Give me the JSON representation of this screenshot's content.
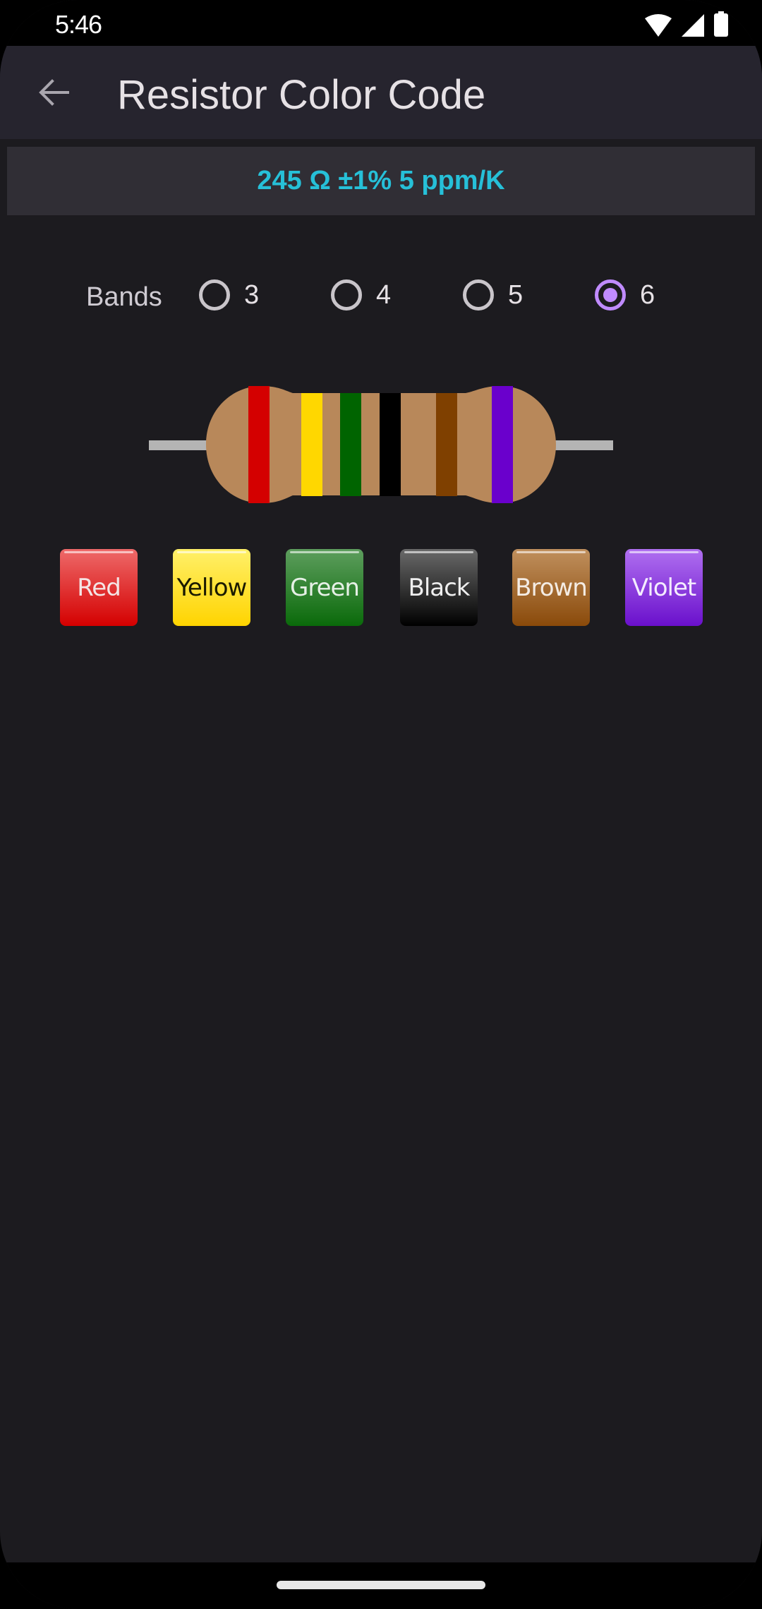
{
  "status_bar": {
    "time": "5:46",
    "icons": [
      "wifi-icon",
      "signal-icon",
      "battery-icon"
    ]
  },
  "app_bar": {
    "back_icon": "arrow-back-icon",
    "title": "Resistor Color Code"
  },
  "result": {
    "text": "245 Ω ±1% 5 ppm/K",
    "color": "#26c0d8"
  },
  "bands": {
    "label": "Bands",
    "options": [
      {
        "label": "3",
        "checked": false
      },
      {
        "label": "4",
        "checked": false
      },
      {
        "label": "5",
        "checked": false
      },
      {
        "label": "6",
        "checked": true
      }
    ],
    "accent": "#c08bff"
  },
  "resistor": {
    "body_color": "#b8885a",
    "lead_color": "#b4b4b4",
    "bands": [
      {
        "name": "Red",
        "color": "#d40000"
      },
      {
        "name": "Yellow",
        "color": "#ffd700"
      },
      {
        "name": "Green",
        "color": "#006400"
      },
      {
        "name": "Black",
        "color": "#000000"
      },
      {
        "name": "Brown",
        "color": "#7f4000"
      },
      {
        "name": "Violet",
        "color": "#6a00cc"
      }
    ]
  },
  "color_buttons": [
    {
      "label": "Red",
      "top": "#ee6a6a",
      "bottom": "#d40000",
      "text": "#f4e4e4"
    },
    {
      "label": "Yellow",
      "top": "#fff06a",
      "bottom": "#ffd400",
      "text": "#1a1a00"
    },
    {
      "label": "Green",
      "top": "#5e9e5e",
      "bottom": "#0a6a0a",
      "text": "#e6f0e6"
    },
    {
      "label": "Black",
      "top": "#6a6a6a",
      "bottom": "#000000",
      "text": "#eeeeee"
    },
    {
      "label": "Brown",
      "top": "#c0905e",
      "bottom": "#8a4a0a",
      "text": "#f4ece4"
    },
    {
      "label": "Violet",
      "top": "#b070f0",
      "bottom": "#6a10cc",
      "text": "#f4ecff"
    }
  ]
}
